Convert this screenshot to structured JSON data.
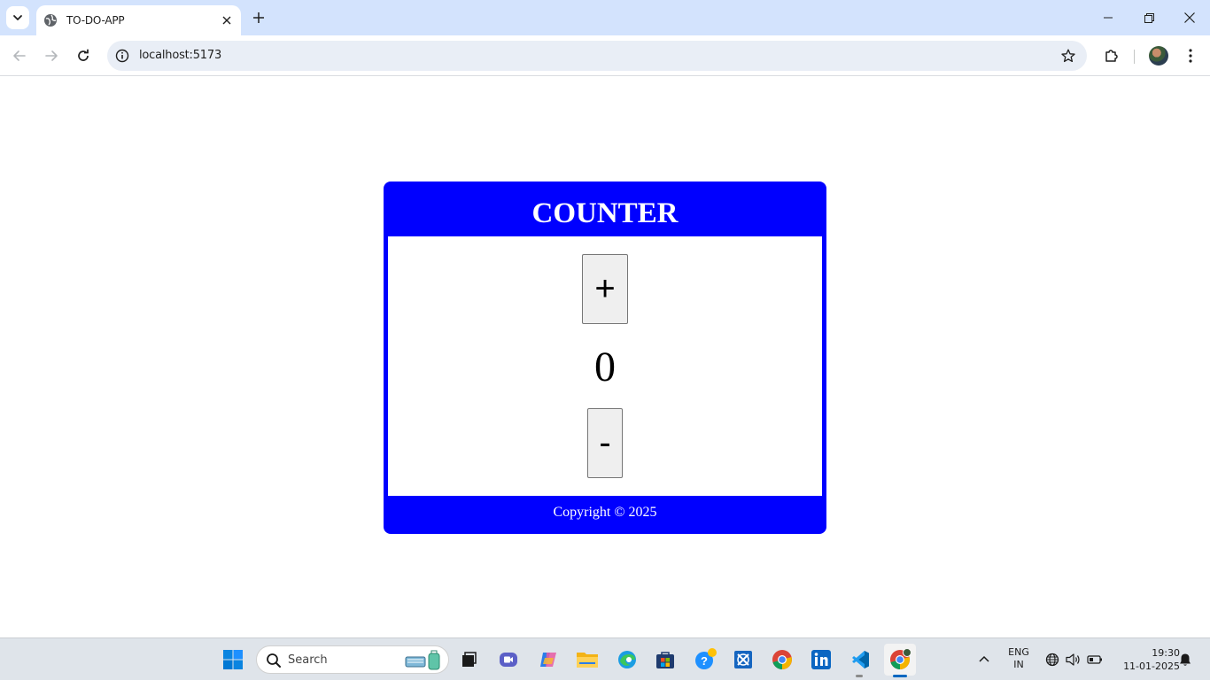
{
  "browser": {
    "tab_title": "TO-DO-APP",
    "url": "localhost:5173"
  },
  "app": {
    "title": "COUNTER",
    "increment_label": "+",
    "count": "0",
    "decrement_label": "-",
    "footer": "Copyright © 2025"
  },
  "colors": {
    "card_blue": "#0000ff",
    "tabbar": "#d3e3fd",
    "button_face": "#efefef"
  },
  "taskbar": {
    "search_placeholder": "Search",
    "language": "ENG",
    "region": "IN",
    "time": "19:30",
    "date": "11-01-2025",
    "pinned_apps": [
      "start-icon",
      "file-explorer-icon",
      "teams-meet-icon",
      "copilot-icon",
      "folder-icon",
      "edge-icon",
      "store-icon",
      "help-icon",
      "remote-desktop-icon",
      "chrome-icon",
      "linkedin-icon",
      "vscode-icon",
      "chrome-profile-icon"
    ]
  }
}
